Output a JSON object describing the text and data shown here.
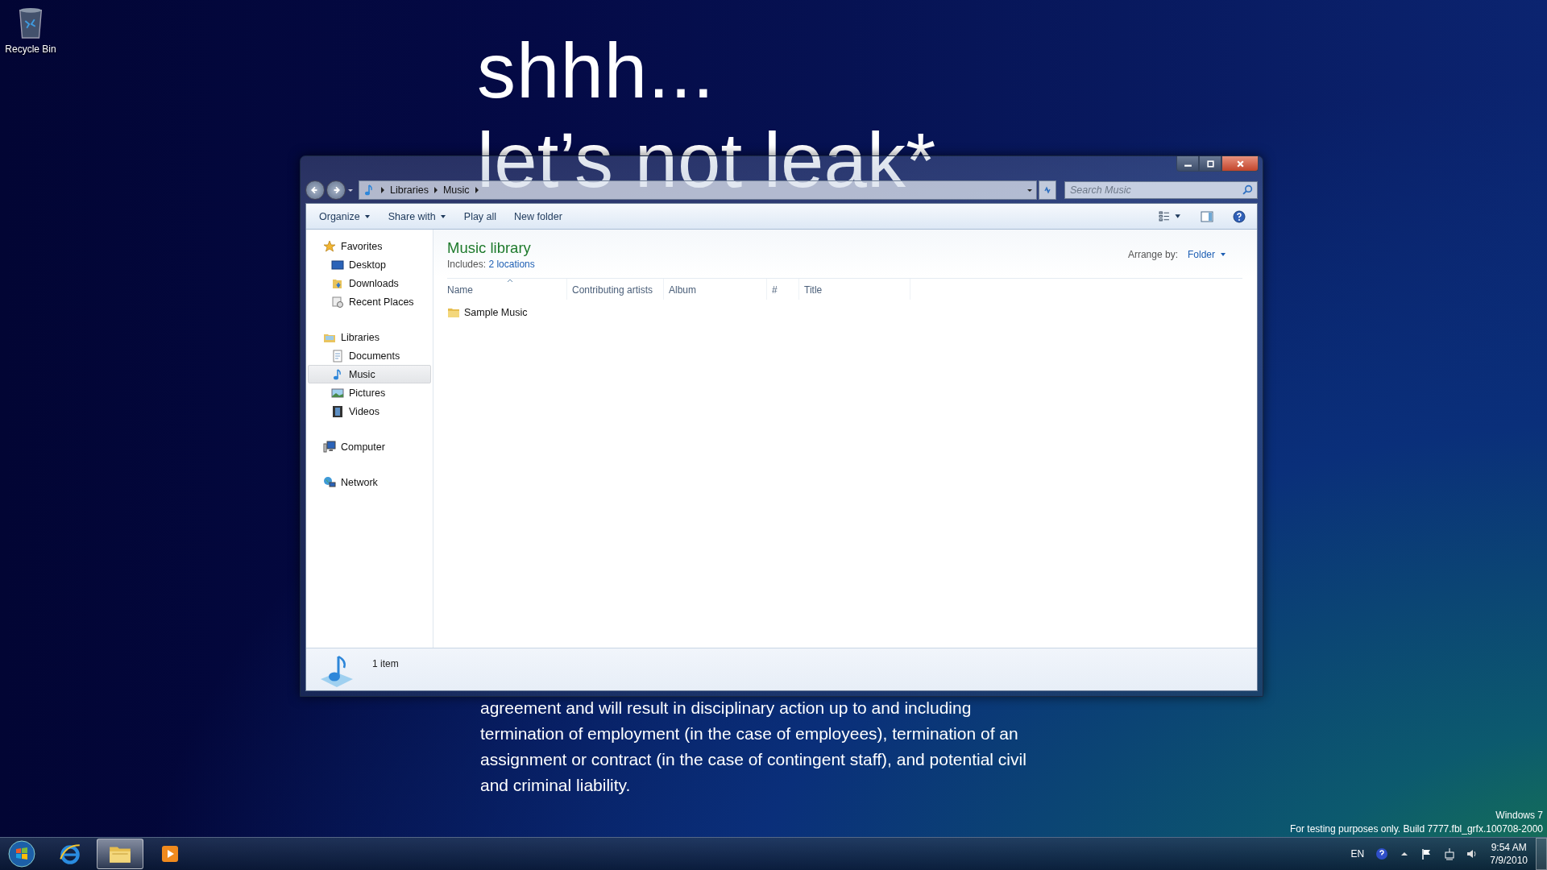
{
  "desktop_icons": [
    {
      "label": "Recycle Bin",
      "kind": "recycle"
    }
  ],
  "wallpaper": {
    "headline": "shhh...",
    "subheadline": "let’s not leak*",
    "paragraph": "agreement and will result in disciplinary action up to and including\ntermination of employment (in the case of employees), termination of an\nassignment or contract (in the case of contingent staff), and potential civil\nand criminal liability."
  },
  "window": {
    "breadcrumbs": [
      "Libraries",
      "Music"
    ],
    "search": {
      "placeholder": "Search Music"
    },
    "toolbar": [
      {
        "label": "Organize",
        "dropdown": true
      },
      {
        "label": "Share with",
        "dropdown": true
      },
      {
        "label": "Play all",
        "dropdown": false
      },
      {
        "label": "New folder",
        "dropdown": false
      }
    ],
    "nav": [
      {
        "label": "Favorites",
        "kind": "star",
        "selected": false,
        "children": [
          {
            "label": "Desktop",
            "kind": "desktop",
            "selected": false
          },
          {
            "label": "Downloads",
            "kind": "downloads",
            "selected": false
          },
          {
            "label": "Recent Places",
            "kind": "recent",
            "selected": false
          }
        ]
      },
      {
        "label": "Libraries",
        "kind": "libraries",
        "selected": false,
        "children": [
          {
            "label": "Documents",
            "kind": "documents",
            "selected": false
          },
          {
            "label": "Music",
            "kind": "music",
            "selected": true
          },
          {
            "label": "Pictures",
            "kind": "pictures",
            "selected": false
          },
          {
            "label": "Videos",
            "kind": "videos",
            "selected": false
          }
        ]
      },
      {
        "label": "Computer",
        "kind": "computer",
        "selected": false
      },
      {
        "label": "Network",
        "kind": "network",
        "selected": false
      }
    ],
    "library": {
      "title": "Music library",
      "includes_label": "Includes:",
      "includes_link": "2 locations",
      "arrange_label": "Arrange by:",
      "arrange_value": "Folder"
    },
    "columns": [
      {
        "label": "Name",
        "sorted": true
      },
      {
        "label": "Contributing artists",
        "sorted": false
      },
      {
        "label": "Album",
        "sorted": false
      },
      {
        "label": "#",
        "sorted": false
      },
      {
        "label": "Title",
        "sorted": false
      }
    ],
    "rows": [
      {
        "name": "Sample Music",
        "kind": "folder"
      }
    ],
    "status": "1 item"
  },
  "build_notice": [
    "Windows 7",
    "For testing purposes only. Build 7777.fbl_grfx.100708-2000"
  ],
  "taskbar": {
    "items": [
      {
        "kind": "start",
        "active": false
      },
      {
        "kind": "browser",
        "active": false
      },
      {
        "kind": "explorer",
        "active": true
      },
      {
        "kind": "media",
        "active": false
      }
    ],
    "language": "EN",
    "time": "9:54 AM",
    "date": "7/9/2010"
  }
}
